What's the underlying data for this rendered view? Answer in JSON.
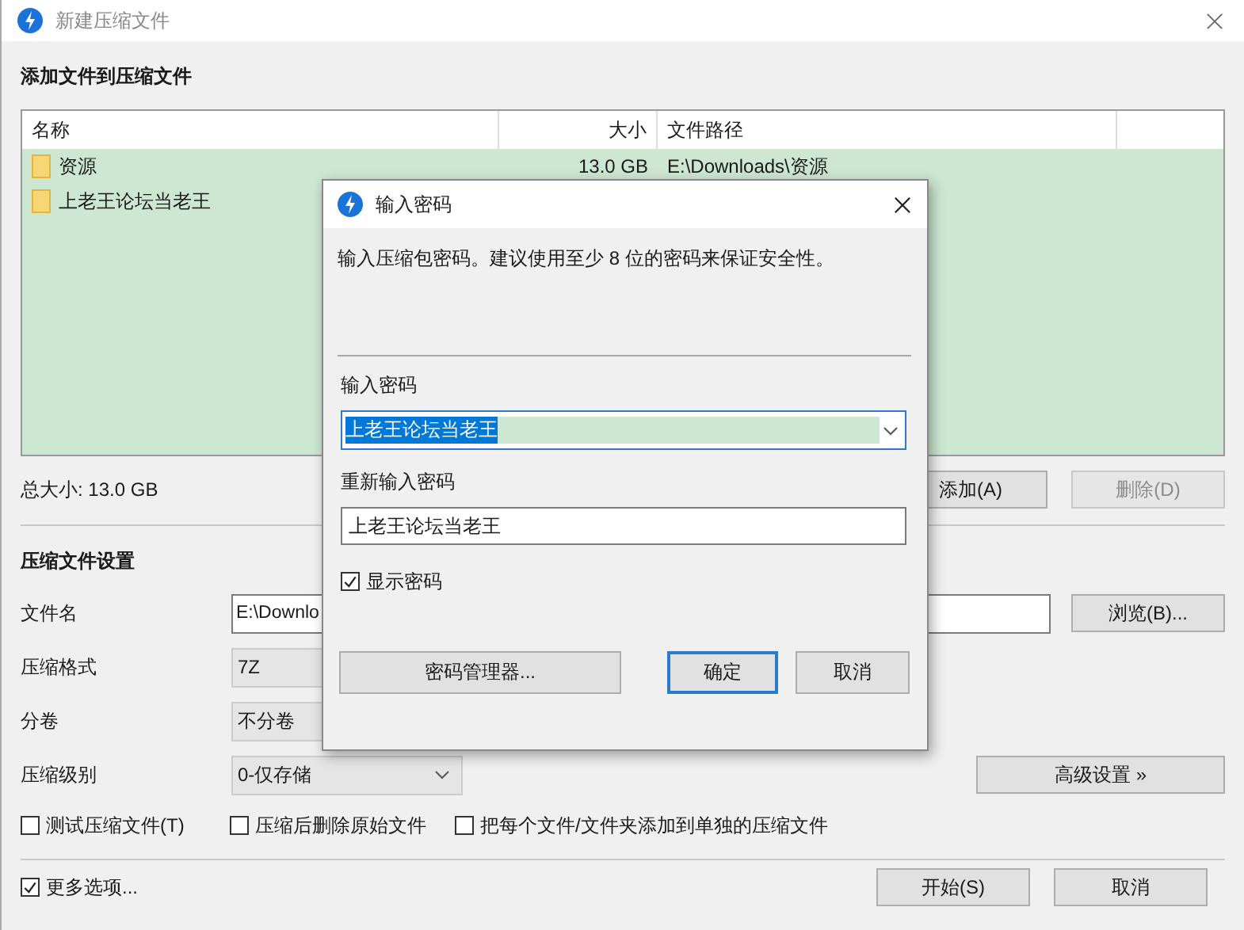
{
  "window": {
    "title": "新建压缩文件"
  },
  "add_section": {
    "title": "添加文件到压缩文件"
  },
  "file_list": {
    "columns": [
      "名称",
      "大小",
      "文件路径"
    ],
    "rows": [
      {
        "name": "资源",
        "size": "13.0 GB",
        "path": "E:\\Downloads\\资源",
        "selected": true
      },
      {
        "name": "上老王论坛当老王",
        "selected": true
      }
    ]
  },
  "total_size": "总大小: 13.0 GB",
  "list_buttons": [
    {
      "label": "添加(A)",
      "disabled": false
    },
    {
      "label": "删除(D)",
      "disabled": true
    }
  ],
  "settings": {
    "title": "压缩文件设置",
    "fields": [
      {
        "kind": "input",
        "label": "文件名",
        "value": "E:\\Downlo",
        "button": "浏览(B)..."
      },
      {
        "kind": "select",
        "label": "压缩格式",
        "value": "7Z"
      },
      {
        "kind": "select",
        "label": "分卷",
        "value": "不分卷"
      },
      {
        "kind": "dropdown",
        "label": "压缩级别",
        "value": "0-仅存储",
        "button": "高级设置 »"
      }
    ],
    "options": [
      {
        "label": "测试压缩文件(T)",
        "checked": false
      },
      {
        "label": "压缩后删除原始文件",
        "checked": false
      },
      {
        "label": "把每个文件/文件夹添加到单独的压缩文件",
        "checked": false
      }
    ]
  },
  "more_options": {
    "label": "更多选项...",
    "checked": true
  },
  "footer_buttons": [
    "开始(S)",
    "取消"
  ],
  "dialog": {
    "title": "输入密码",
    "description": "输入压缩包密码。建议使用至少 8 位的密码来保证安全性。",
    "password": {
      "label": "输入密码",
      "value": "上老王论坛当老王",
      "highlighted": true
    },
    "confirm": {
      "label": "重新输入密码",
      "value": "上老王论坛当老王"
    },
    "show_password": {
      "label": "显示密码",
      "checked": true
    },
    "buttons": [
      {
        "label": "密码管理器...",
        "default": false
      },
      {
        "label": "确定",
        "default": true
      },
      {
        "label": "取消",
        "default": false
      }
    ]
  }
}
